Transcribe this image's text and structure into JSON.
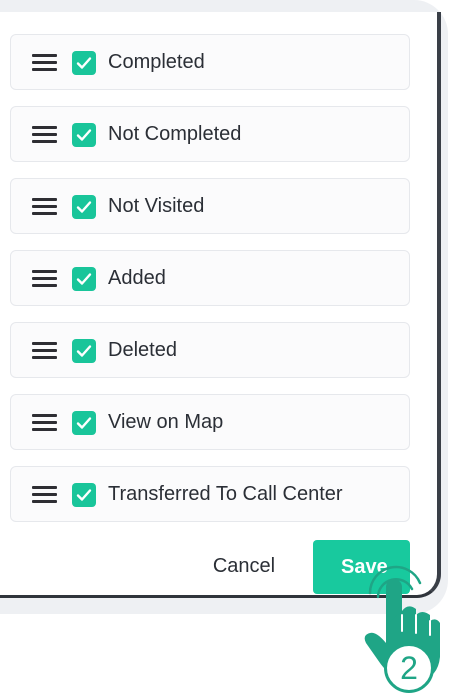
{
  "rows": [
    {
      "label": "Completed",
      "checked": true
    },
    {
      "label": "Not Completed",
      "checked": true
    },
    {
      "label": "Not Visited",
      "checked": true
    },
    {
      "label": "Added",
      "checked": true
    },
    {
      "label": "Deleted",
      "checked": true
    },
    {
      "label": "View on Map",
      "checked": true
    },
    {
      "label": "Transferred To Call Center",
      "checked": true
    }
  ],
  "actions": {
    "cancel_label": "Cancel",
    "save_label": "Save"
  },
  "annotation": {
    "step_number": "2"
  },
  "colors": {
    "accent": "#19c59a",
    "text": "#2b2f36",
    "row_bg": "#fbfbfc",
    "row_border": "#e6e8ec",
    "hand": "#1fa586"
  },
  "icons": {
    "drag": "drag-handle-icon",
    "check": "check-icon",
    "pointer": "hand-pointer-icon"
  }
}
